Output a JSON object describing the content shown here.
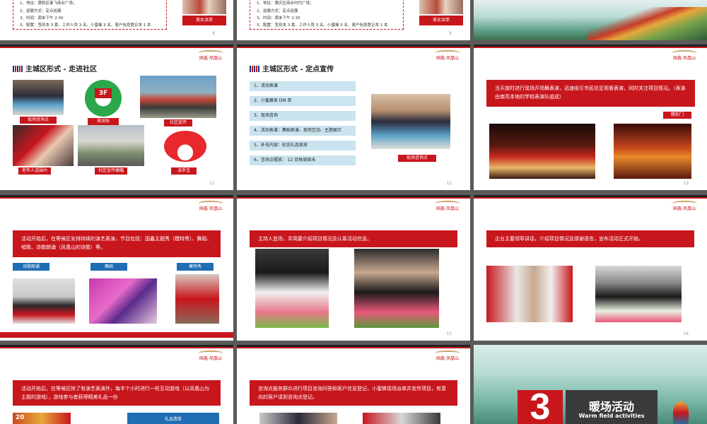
{
  "slides": {
    "s08": {
      "lines": [
        "1、地址：惠阳区奋飞商业广场；",
        "2、巡展方式：定点巡展",
        "3、时间：周末下午 2:30",
        "3、配置：签到本 3 套、工作人员 3 名、小蜜蜂 5 名、客户信息登记本 1 本"
      ],
      "caption": "美女派单",
      "page": "8"
    },
    "s09": {
      "lines": [
        "1、地址：惠庆区商业时代广场；",
        "2、巡展方式：定点巡展",
        "3、时间：周末下午 2:30",
        "3、配置：签到本 3 套、工作人员 3 名、小蜜蜂 5 名、客户信息登记本 1 本"
      ],
      "caption": "美女派单",
      "page": "9"
    },
    "s11": {
      "title": "主城区形式 - 走进社区",
      "captions": [
        "现场咨询点",
        "排派贴",
        "社区宣传",
        "老年人送围巾",
        "社区宣传横幅",
        "派手宝"
      ],
      "sticker": "3F",
      "page": "11"
    },
    "s12": {
      "title": "主城区形式 - 定点宣传",
      "items": [
        "1、活动表演",
        "2、小蜜蜂发 DM 单",
        "3、现场咨询",
        "4、活动表演：舞蹈表演、现场互动、主题展示",
        "5、补充内容：纪念礼品发放",
        "6、咨询点摆放： 12 月每周周末"
      ],
      "caption": "现场咨询点",
      "page": "12"
    },
    "s13": {
      "text": "当天按时进行现场开场舞表演，迅速吸引市民驻足观看表演，同时关注项目情况。（表演由南亮本地的学校表演队组成）",
      "caption": "精彩门",
      "page": "13"
    },
    "s14": {
      "text": "活动开始后，在等候区安排持续的演艺表演，节目包括：国鑫主题秀（模特秀）、舞蹈、唱歌、诗歌朗诵（凤凰山的诗歌）等。",
      "tags": [
        "诗歌朗诵",
        "舞蹈",
        "模特秀"
      ]
    },
    "s15": {
      "text": "主持人登场，并简要介绍项目情况及认筹活动信息。",
      "page": "15"
    },
    "s16": {
      "text": "企业主要领导讲话，介绍项目情况及感谢语言，宣布活动正式开始。",
      "page": "16"
    },
    "s17": {
      "text": "活动开始后，在等候区除了有演艺表演外，每半个小时进行一轮互动游戏（以凤凰山为主题的游戏），游戏参与者获得精美礼品一份",
      "gift_label": "礼品清单",
      "stamp": "20"
    },
    "s18": {
      "text": "咨询点服务群众进行项目咨询问答和客户信息登记，小蜜蜂现场派单并宣传项目，有意向的客户请到咨询点登记。"
    },
    "s19": {
      "number": "3",
      "title_cn": "暖场活动",
      "title_en": "Warm field activities"
    }
  },
  "logo_text": "国鑫·凤凰山"
}
